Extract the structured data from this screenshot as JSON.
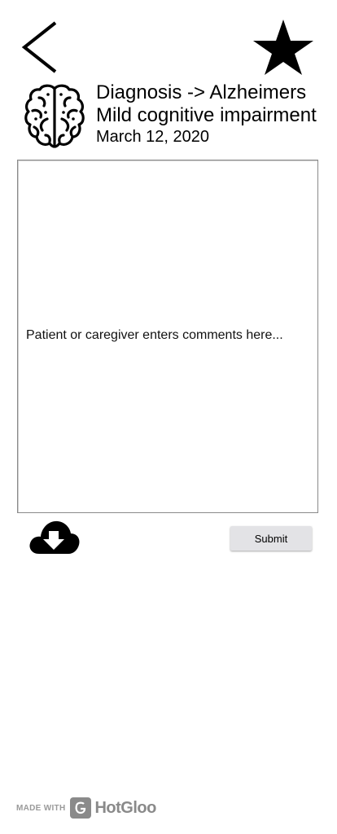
{
  "header": {
    "back_icon": "chevron-left-icon",
    "favorite_icon": "star-icon"
  },
  "diagnosis": {
    "icon": "brain-icon",
    "title": "Diagnosis -> Alzheimers",
    "subtitle": "Mild cognitive impairment",
    "date": "March 12, 2020"
  },
  "comments": {
    "placeholder": "Patient or caregiver enters comments here..."
  },
  "actions": {
    "download_icon": "cloud-download-icon",
    "submit_label": "Submit"
  },
  "footer": {
    "made_with": "MADE WITH",
    "brand": "HotGloo"
  }
}
